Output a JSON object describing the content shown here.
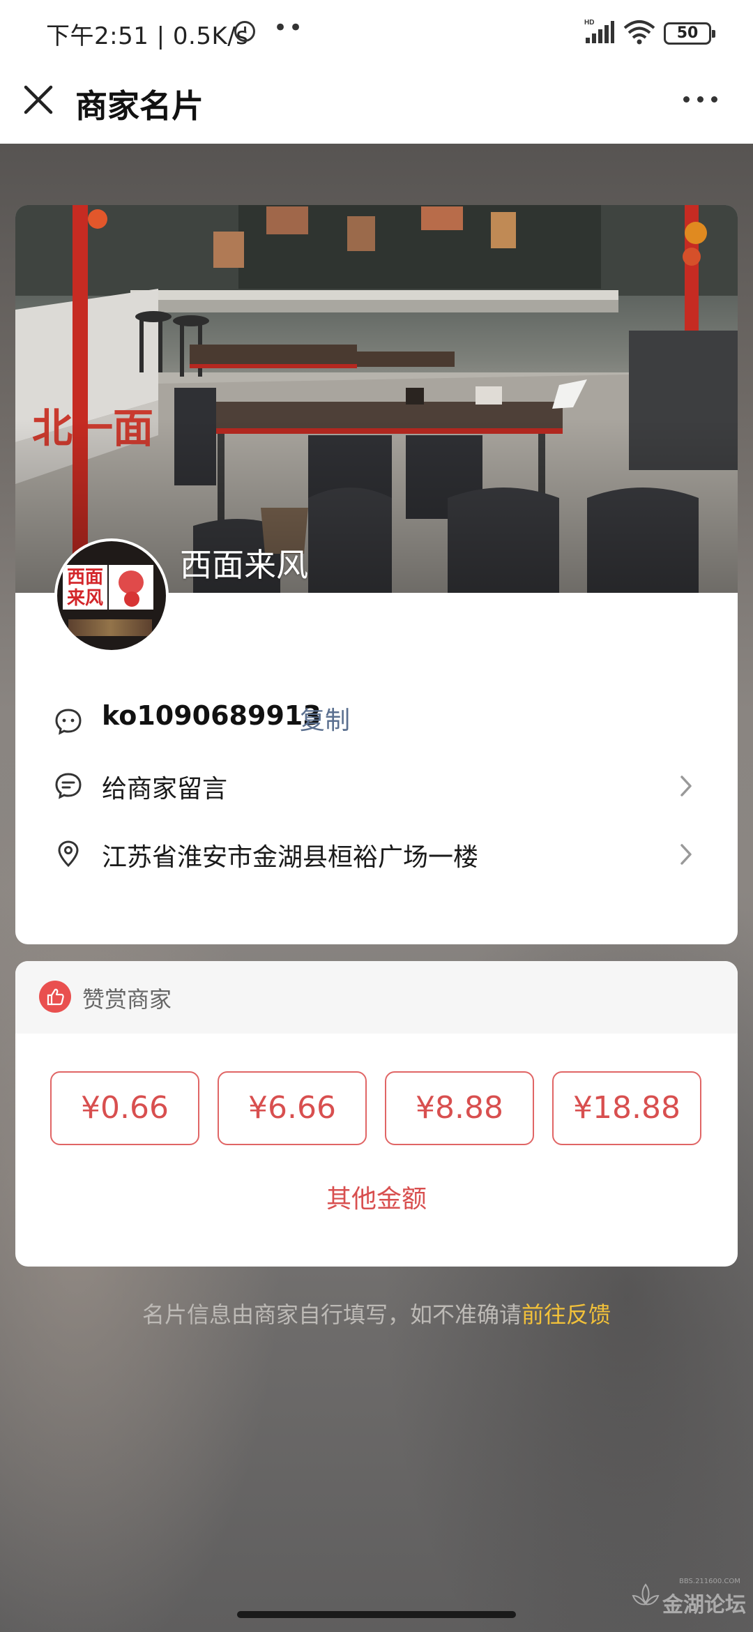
{
  "status_bar": {
    "time": "下午2:51 | 0.5K/s",
    "dots": "••",
    "network": "HD",
    "battery": "50"
  },
  "nav": {
    "title": "商家名片",
    "close_icon": "close-icon",
    "more_icon": "more-icon"
  },
  "merchant": {
    "name": "西面来风",
    "avatar_sign_text": "西面来风",
    "id": "ko1090689913",
    "copy_label": "复制",
    "message_label": "给商家留言",
    "address": "江苏省淮安市金湖县桓裕广场一楼"
  },
  "tip": {
    "title": "赞赏商家",
    "amounts": [
      "¥0.66",
      "¥6.66",
      "¥8.88",
      "¥18.88"
    ],
    "other_label": "其他金额"
  },
  "footer": {
    "note": "名片信息由商家自行填写，如不准确请",
    "link": "前往反馈"
  },
  "watermark": {
    "text": "金湖论坛",
    "url": "BBS.211600.COM"
  },
  "colors": {
    "accent_red": "#d84f4f",
    "link_blue": "#5a6f8f",
    "feedback_yellow": "#f2c13a"
  }
}
